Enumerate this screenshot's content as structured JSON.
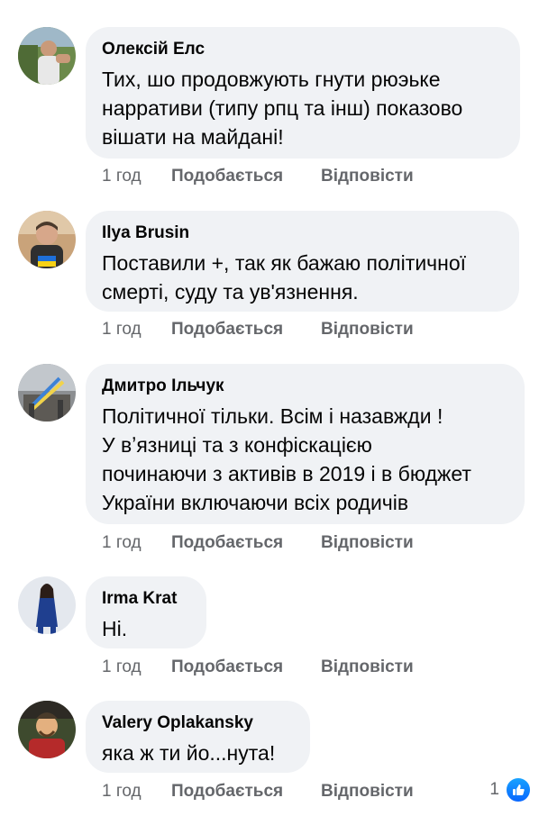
{
  "comments": [
    {
      "author": "Олексій Елс",
      "text": "Тих, шо продовжують гнути рюэьке\nнарративи (типу рпц та інш) показово\nвішати на майдані!",
      "time": "1 год",
      "like_label": "Подобається",
      "reply_label": "Відповісти"
    },
    {
      "author": "Ilya Brusin",
      "text": "Поставили +, так як бажаю політичної\nсмерті, суду та ув'язнення.",
      "time": "1 год",
      "like_label": "Подобається",
      "reply_label": "Відповісти"
    },
    {
      "author": "Дмитро Ільчук",
      "text": "Політичної тільки. Всім і назавжди !\nУ вʼязниці та з конфіскацією\nпочинаючи з активів в 2019 і в бюджет\nУкраїни включаючи всіх родичів",
      "time": "1 год",
      "like_label": "Подобається",
      "reply_label": "Відповісти"
    },
    {
      "author": "Irma Krat",
      "text": "Ні.",
      "time": "1 год",
      "like_label": "Подобається",
      "reply_label": "Відповісти"
    },
    {
      "author": "Valery Oplakansky",
      "text": "яка ж ти йо...нута!",
      "time": "1 год",
      "like_label": "Подобається",
      "reply_label": "Відповісти",
      "reaction_count": "1",
      "reaction_icon": "thumbs-up-icon"
    }
  ],
  "colors": {
    "bubble": "#f0f2f5",
    "meta_text": "#65676b",
    "like_blue": "#0866ff"
  }
}
